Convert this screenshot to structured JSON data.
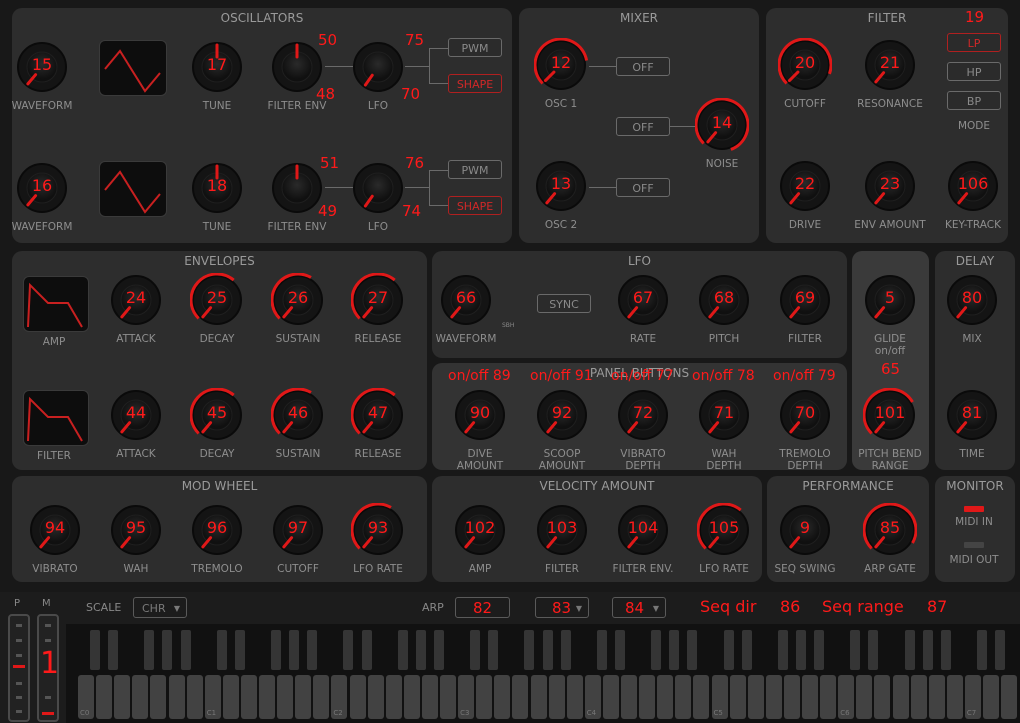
{
  "panels": {
    "oscillators": "OSCILLATORS",
    "mixer": "MIXER",
    "filter": "FILTER",
    "envelopes": "ENVELOPES",
    "lfo": "LFO",
    "delay": "DELAY",
    "panel_buttons": "PANEL BUTTONS",
    "mod_wheel": "MOD WHEEL",
    "velocity": "VELOCITY AMOUNT",
    "performance": "PERFORMANCE",
    "monitor": "MONITOR"
  },
  "knobs": [
    {
      "label": "WAVEFORM",
      "value": "15"
    },
    {
      "label": "TUNE",
      "value": "17"
    },
    {
      "label": "FILTER ENV",
      "value": ""
    },
    {
      "label": "LFO",
      "value": ""
    },
    {
      "label": "WAVEFORM",
      "value": "16"
    },
    {
      "label": "TUNE",
      "value": "18"
    },
    {
      "label": "FILTER ENV",
      "value": ""
    },
    {
      "label": "LFO",
      "value": ""
    },
    {
      "label": "OSC 1",
      "value": "12"
    },
    {
      "label": "NOISE",
      "value": "14"
    },
    {
      "label": "OSC 2",
      "value": "13"
    },
    {
      "label": "CUTOFF",
      "value": "20"
    },
    {
      "label": "RESONANCE",
      "value": "21"
    },
    {
      "label": "DRIVE",
      "value": "22"
    },
    {
      "label": "ENV AMOUNT",
      "value": "23"
    },
    {
      "label": "KEY-TRACK",
      "value": "106"
    },
    {
      "label": "ATTACK",
      "value": "24"
    },
    {
      "label": "DECAY",
      "value": "25"
    },
    {
      "label": "SUSTAIN",
      "value": "26"
    },
    {
      "label": "RELEASE",
      "value": "27"
    },
    {
      "label": "ATTACK",
      "value": "44"
    },
    {
      "label": "DECAY",
      "value": "45"
    },
    {
      "label": "SUSTAIN",
      "value": "46"
    },
    {
      "label": "RELEASE",
      "value": "47"
    },
    {
      "label": "WAVEFORM",
      "value": "66"
    },
    {
      "label": "RATE",
      "value": "67"
    },
    {
      "label": "PITCH",
      "value": "68"
    },
    {
      "label": "FILTER",
      "value": "69"
    },
    {
      "label": "GLIDE\non/off",
      "value": "5"
    },
    {
      "label": "PITCH BEND\nRANGE",
      "value": "101"
    },
    {
      "label": "MIX",
      "value": "80"
    },
    {
      "label": "TIME",
      "value": "81"
    },
    {
      "label": "DIVE\nAMOUNT",
      "value": "90"
    },
    {
      "label": "SCOOP\nAMOUNT",
      "value": "92"
    },
    {
      "label": "VIBRATO\nDEPTH",
      "value": "72"
    },
    {
      "label": "WAH\nDEPTH",
      "value": "71"
    },
    {
      "label": "TREMOLO\nDEPTH",
      "value": "70"
    },
    {
      "label": "VIBRATO",
      "value": "94"
    },
    {
      "label": "WAH",
      "value": "95"
    },
    {
      "label": "TREMOLO",
      "value": "96"
    },
    {
      "label": "CUTOFF",
      "value": "97"
    },
    {
      "label": "LFO RATE",
      "value": "93"
    },
    {
      "label": "AMP",
      "value": "102"
    },
    {
      "label": "FILTER",
      "value": "103"
    },
    {
      "label": "FILTER ENV.",
      "value": "104"
    },
    {
      "label": "LFO RATE",
      "value": "105"
    },
    {
      "label": "SEQ SWING",
      "value": "9"
    },
    {
      "label": "ARP GATE",
      "value": "85"
    }
  ],
  "cc_labels": {
    "osc1_fenv_top": "50",
    "osc1_fenv_bot": "48",
    "osc1_lfo_top": "75",
    "osc1_lfo_bot": "70",
    "osc2_fenv_top": "51",
    "osc2_fenv_bot": "49",
    "osc2_lfo_top": "76",
    "osc2_lfo_bot": "74",
    "filter_mode": "19",
    "glide_onoff": "65",
    "panel_onoff": [
      "on/off 89",
      "on/off 91",
      "on/off 77",
      "on/off 78",
      "on/off 79"
    ]
  },
  "buttons": {
    "pwm": "PWM",
    "shape": "SHAPE",
    "off": "OFF",
    "lp": "LP",
    "hp": "HP",
    "bp": "BP",
    "mode": "MODE",
    "sync": "SYNC",
    "lfo_sbh": "SBH"
  },
  "displays": {
    "amp": "AMP",
    "filter": "FILTER"
  },
  "monitor": {
    "midi_in": "MIDI IN",
    "midi_out": "MIDI OUT"
  },
  "bottom": {
    "p": "P",
    "m": "M",
    "mod_value": "1",
    "scale_label": "SCALE",
    "scale_value": "CHR",
    "arp_label": "ARP",
    "arp_mode": "82",
    "arp_dir": "83",
    "arp_range": "84",
    "seq_dir": "Seq dir",
    "seq_dir_cc": "86",
    "seq_range": "Seq range",
    "seq_range_cc": "87"
  },
  "keyboard": {
    "octave_labels": [
      "C0",
      "C1",
      "C2",
      "C3",
      "C4",
      "C5",
      "C6",
      "C7"
    ]
  },
  "colors": {
    "accent": "#ff1a1a",
    "panel": "#2d2d2d",
    "background": "#181818"
  }
}
